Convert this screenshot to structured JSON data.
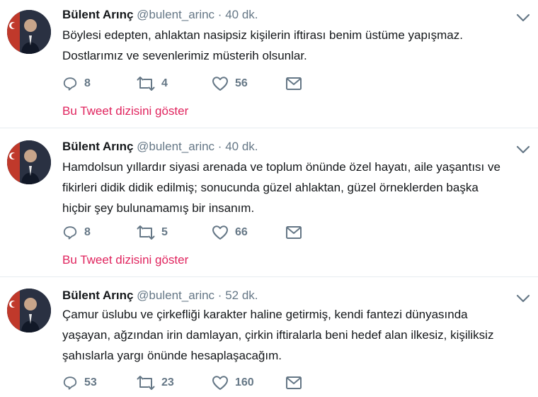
{
  "theme": {
    "accent_red": "#e0245e",
    "muted": "#657786",
    "text": "#14171a",
    "divider": "#e6ecf0"
  },
  "tweets": [
    {
      "name": "Bülent Arınç",
      "handle": "@bulent_arinc",
      "dot": "·",
      "time": "40 dk.",
      "lines": [
        "Böylesi edepten, ahlaktan nasipsiz kişilerin iftirası benim üstüme yapışmaz.",
        "Dostlarımız ve sevenlerimiz müsterih olsunlar."
      ],
      "replies": "8",
      "retweets": "4",
      "likes": "56",
      "show_thread": "Bu Tweet dizisini göster"
    },
    {
      "name": "Bülent Arınç",
      "handle": "@bulent_arinc",
      "dot": "·",
      "time": "40 dk.",
      "lines": [
        "Hamdolsun yıllardır siyasi arenada ve toplum önünde özel hayatı, aile yaşantısı ve",
        "fikirleri didik didik edilmiş; sonucunda güzel ahlaktan, güzel örneklerden başka",
        "hiçbir şey bulunamamış bir insanım."
      ],
      "replies": "8",
      "retweets": "5",
      "likes": "66",
      "show_thread": "Bu Tweet dizisini göster"
    },
    {
      "name": "Bülent Arınç",
      "handle": "@bulent_arinc",
      "dot": "·",
      "time": "52 dk.",
      "lines": [
        "Çamur üslubu ve çirkefliği karakter haline getirmiş, kendi fantezi dünyasında",
        "yaşayan, ağzından irin damlayan, çirkin iftiralarla beni hedef alan ilkesiz, kişiliksiz",
        "şahıslarla yargı önünde hesaplaşacağım."
      ],
      "replies": "53",
      "retweets": "23",
      "likes": "160"
    }
  ],
  "icons": {
    "reply": "reply-icon",
    "retweet": "retweet-icon",
    "like": "heart-icon",
    "dm": "envelope-icon",
    "more": "chevron-down-icon",
    "avatar": "profile-photo"
  }
}
